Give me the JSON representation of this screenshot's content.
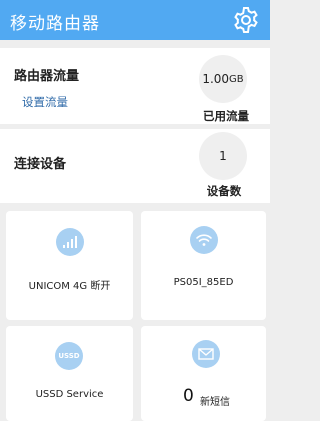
{
  "app": {
    "title": "移动路由器",
    "settings_icon": "gear-icon"
  },
  "traffic": {
    "label": "路由器流量",
    "set_link": "设置流量",
    "used_value": "1.00",
    "used_unit": "GB",
    "used_caption": "已用流量"
  },
  "devices": {
    "label": "连接设备",
    "count": "1",
    "caption": "设备数"
  },
  "tiles": {
    "network": {
      "icon": "signal-icon",
      "label": "UNICOM 4G 断开"
    },
    "wifi": {
      "icon": "wifi-icon",
      "label": "PS05I_85ED"
    },
    "ussd": {
      "icon": "ussd-icon",
      "icon_text": "USSD",
      "label": "USSD Service"
    },
    "sms": {
      "icon": "envelope-icon",
      "count": "0",
      "label": "新短信"
    }
  },
  "colors": {
    "appbar": "#51a9f2",
    "icon_bg": "#a8d0f2",
    "link": "#2f6aa8"
  }
}
